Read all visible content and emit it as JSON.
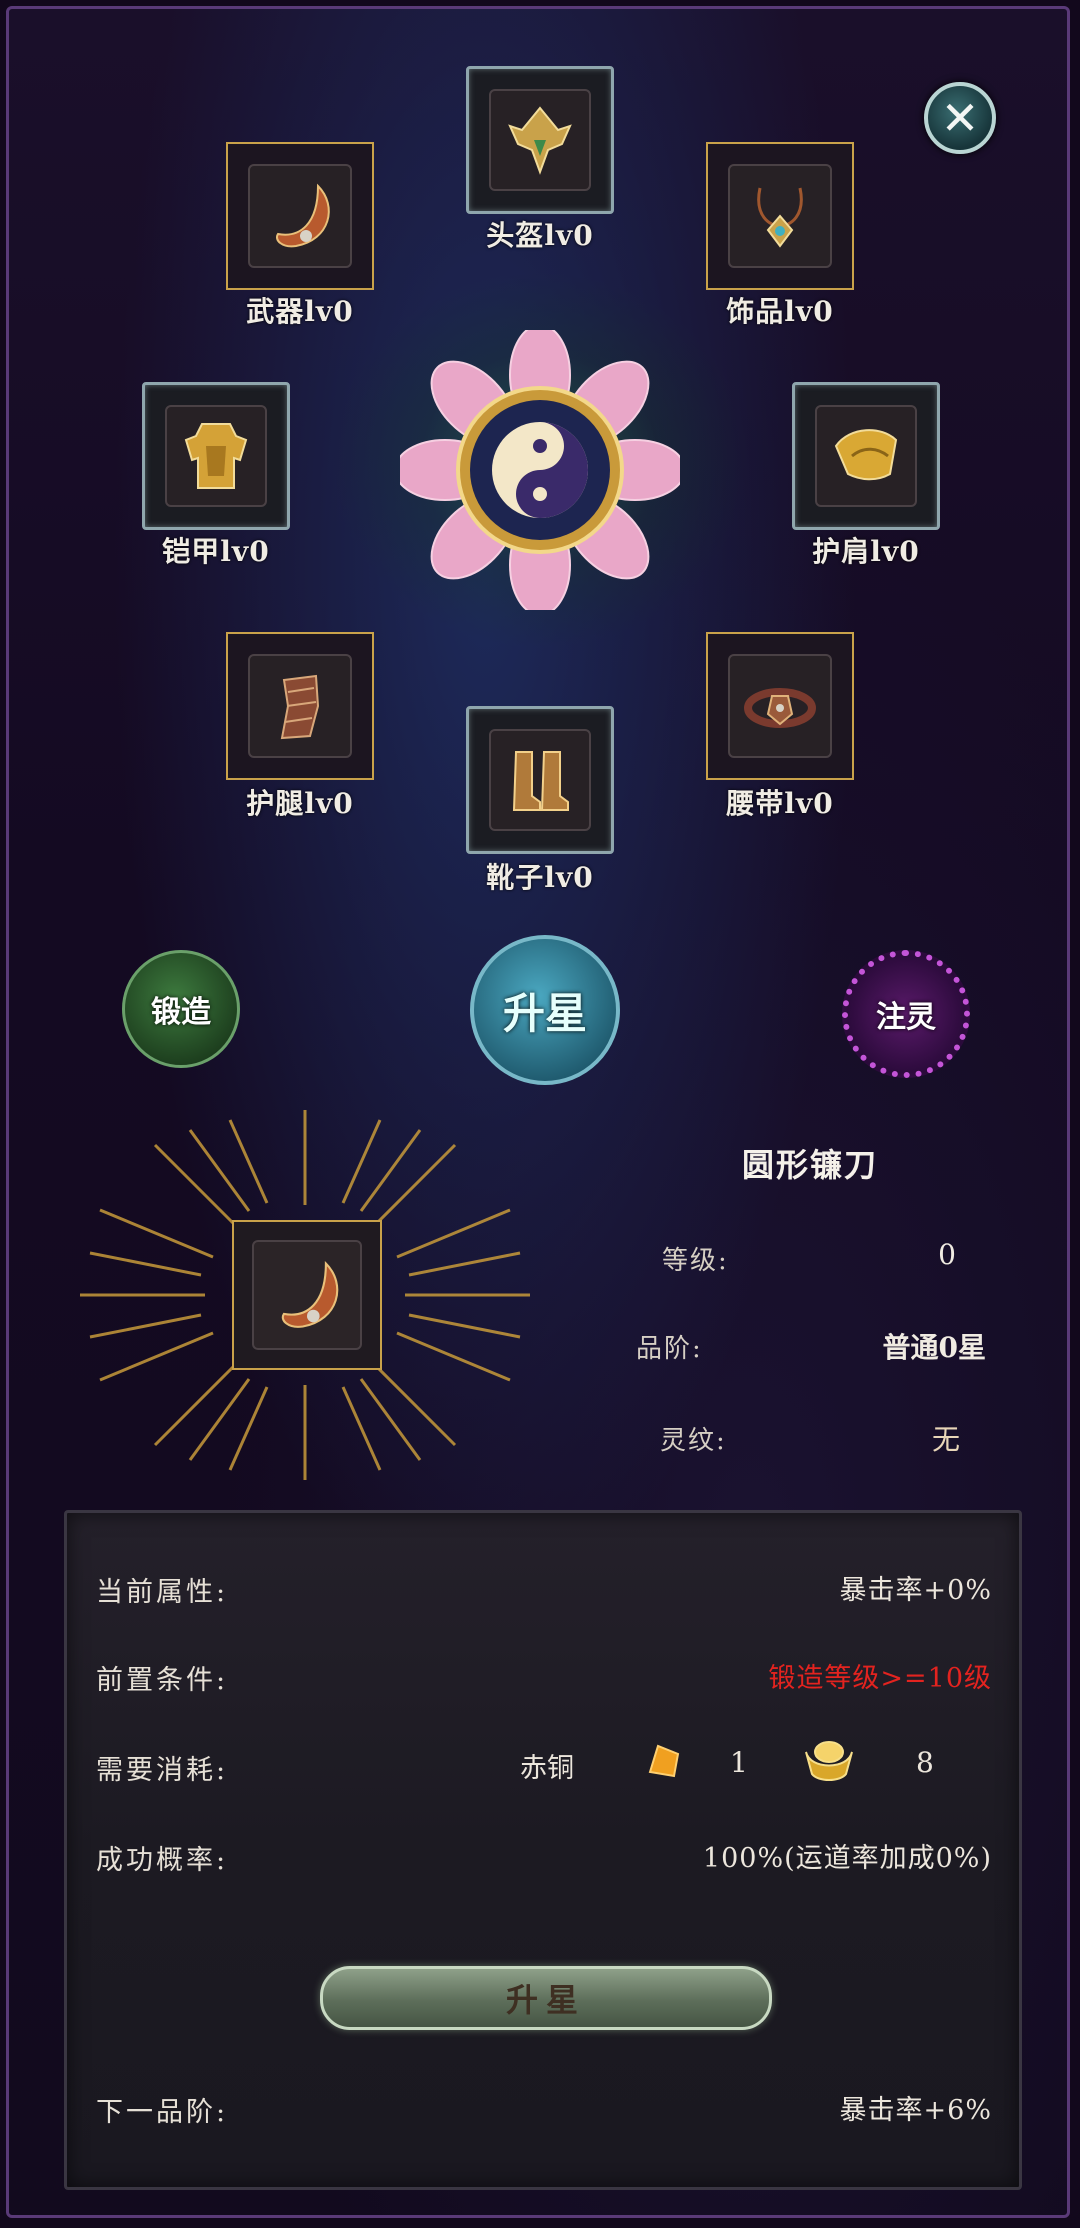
{
  "slots": [
    {
      "id": "helmet",
      "label": "头盔lv0"
    },
    {
      "id": "weapon",
      "label": "武器lv0"
    },
    {
      "id": "accessory",
      "label": "饰品lv0"
    },
    {
      "id": "armor",
      "label": "铠甲lv0"
    },
    {
      "id": "shoulder",
      "label": "护肩lv0"
    },
    {
      "id": "leggings",
      "label": "护腿lv0"
    },
    {
      "id": "belt",
      "label": "腰带lv0"
    },
    {
      "id": "boots",
      "label": "靴子lv0"
    }
  ],
  "actions": {
    "forge": "锻造",
    "star": "升星",
    "spirit": "注灵"
  },
  "item": {
    "name": "圆形镰刀",
    "level_label": "等级:",
    "level_value": "0",
    "grade_label": "品阶:",
    "grade_value": "普通0星",
    "rune_label": "灵纹:",
    "rune_value": "无"
  },
  "panel": {
    "current_label": "当前属性:",
    "current_value": "暴击率+0%",
    "prereq_label": "前置条件:",
    "prereq_value": "锻造等级>=10级",
    "cost_label": "需要消耗:",
    "cost_material": "赤铜",
    "cost_material_qty": "1",
    "cost_gold_qty": "8",
    "success_label": "成功概率:",
    "success_value": "100%(运道率加成0%)",
    "upgrade_button": "升星",
    "next_label": "下一品阶:",
    "next_value": "暴击率+6%"
  },
  "colors": {
    "prereq_text": "#e3231f",
    "gold_frame": "#c9a24a"
  }
}
